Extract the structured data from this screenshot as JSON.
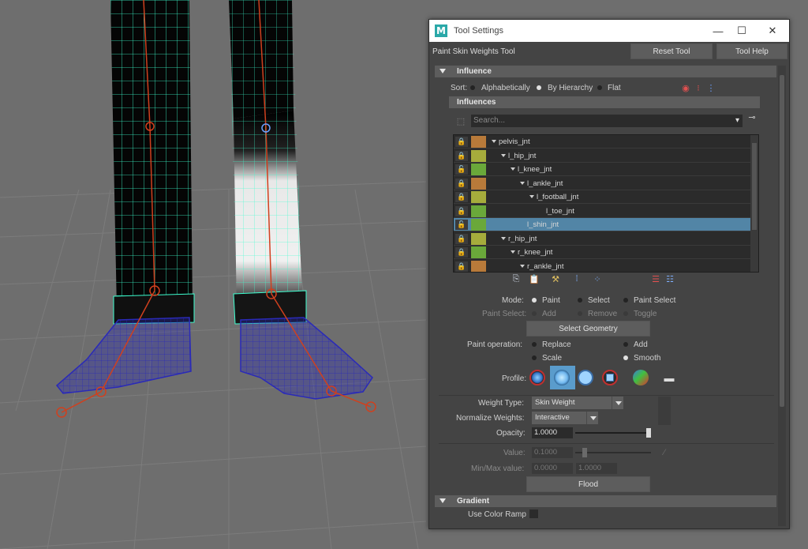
{
  "window": {
    "title": "Tool Settings",
    "tool_name": "Paint Skin Weights Tool",
    "reset_label": "Reset Tool",
    "help_label": "Tool Help",
    "minimize_glyph": "—",
    "maximize_glyph": "☐",
    "close_glyph": "✕",
    "logo_letter": "M"
  },
  "influence": {
    "section_label": "Influence",
    "sort_label": "Sort:",
    "sort_options": [
      "Alphabetically",
      "By Hierarchy",
      "Flat"
    ],
    "sort_selected": "By Hierarchy",
    "influences_header": "Influences",
    "search_placeholder": "Search...",
    "joints": [
      {
        "name": "pelvis_jnt",
        "color": "#b87a3a",
        "depth": 0,
        "expander": true,
        "locked": true,
        "selected": false
      },
      {
        "name": "l_hip_jnt",
        "color": "#a6ac3c",
        "depth": 1,
        "expander": true,
        "locked": true,
        "selected": false
      },
      {
        "name": "l_knee_jnt",
        "color": "#6aa83a",
        "depth": 2,
        "expander": true,
        "locked": false,
        "selected": false
      },
      {
        "name": "l_ankle_jnt",
        "color": "#b87a3a",
        "depth": 3,
        "expander": true,
        "locked": true,
        "selected": false
      },
      {
        "name": "l_football_jnt",
        "color": "#a6ac3c",
        "depth": 4,
        "expander": true,
        "locked": true,
        "selected": false
      },
      {
        "name": "l_toe_jnt",
        "color": "#6aa83a",
        "depth": 5,
        "expander": false,
        "locked": true,
        "selected": false
      },
      {
        "name": "l_shin_jnt",
        "color": "#6aa83a",
        "depth": 3,
        "expander": false,
        "locked": false,
        "selected": true
      },
      {
        "name": "r_hip_jnt",
        "color": "#a6ac3c",
        "depth": 1,
        "expander": true,
        "locked": true,
        "selected": false
      },
      {
        "name": "r_knee_jnt",
        "color": "#6aa83a",
        "depth": 2,
        "expander": true,
        "locked": true,
        "selected": false
      },
      {
        "name": "r_ankle_jnt",
        "color": "#b87a3a",
        "depth": 3,
        "expander": true,
        "locked": true,
        "selected": false
      }
    ]
  },
  "mode": {
    "label": "Mode:",
    "options": [
      "Paint",
      "Select",
      "Paint Select"
    ],
    "selected": "Paint",
    "paint_select_label": "Paint Select:",
    "paint_select_options": [
      "Add",
      "Remove",
      "Toggle"
    ],
    "select_geometry_label": "Select Geometry"
  },
  "paint_operation": {
    "label": "Paint operation:",
    "options": [
      "Replace",
      "Add",
      "Scale",
      "Smooth"
    ],
    "selected": "Smooth"
  },
  "profile": {
    "label": "Profile:",
    "selected_index": 1
  },
  "weights": {
    "weight_type_label": "Weight Type:",
    "weight_type_value": "Skin Weight",
    "normalize_label": "Normalize Weights:",
    "normalize_value": "Interactive",
    "opacity_label": "Opacity:",
    "opacity_value": "1.0000",
    "opacity_fraction": 1.0,
    "value_label": "Value:",
    "value_value": "0.1000",
    "value_fraction": 0.1,
    "minmax_label": "Min/Max value:",
    "min_value": "0.0000",
    "max_value": "1.0000",
    "flood_label": "Flood"
  },
  "gradient": {
    "section_label": "Gradient",
    "use_color_ramp_label": "Use Color Ramp"
  },
  "colors": {
    "selection": "#5285a6",
    "mesh_wire": "#3dffd0",
    "shoe_wire": "#2a2ab8",
    "joint": "#d0401e"
  }
}
